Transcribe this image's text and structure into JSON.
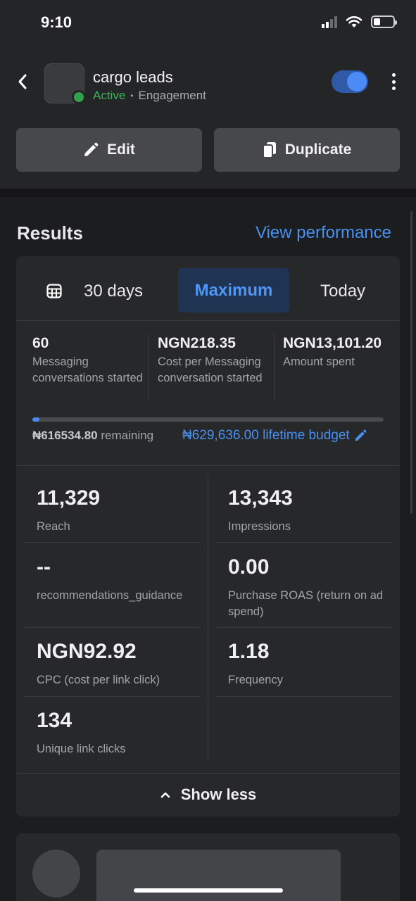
{
  "status_bar": {
    "time": "9:10"
  },
  "header": {
    "campaign_name": "cargo leads",
    "status": "Active",
    "objective": "Engagement",
    "edit_label": "Edit",
    "duplicate_label": "Duplicate",
    "toggle_on": true
  },
  "results": {
    "title": "Results",
    "view_performance": "View performance",
    "ranges": {
      "days": "30 days",
      "maximum": "Maximum",
      "today": "Today",
      "selected": "Maximum"
    },
    "top_metrics": [
      {
        "value": "60",
        "label": "Messaging conversations started"
      },
      {
        "value": "NGN218.35",
        "label": "Cost per Messaging conversation started"
      },
      {
        "value": "NGN13,101.20",
        "label": "Amount spent"
      }
    ],
    "budget": {
      "remaining_amount": "₦616534.80",
      "remaining_label": "remaining",
      "lifetime": "₦629,636.00 lifetime budget",
      "spent_fraction": 0.021
    },
    "grid": {
      "reach": {
        "value": "11,329",
        "label": "Reach"
      },
      "impressions": {
        "value": "13,343",
        "label": "Impressions"
      },
      "recommendations": {
        "value": "--",
        "label": "recommendations_guidance"
      },
      "purchase_roas": {
        "value": "0.00",
        "label": "Purchase ROAS (return on ad spend)"
      },
      "cpc": {
        "value": "NGN92.92",
        "label": "CPC (cost per link click)"
      },
      "frequency": {
        "value": "1.18",
        "label": "Frequency"
      },
      "unique_clicks": {
        "value": "134",
        "label": "Unique link clicks"
      }
    },
    "show_less": "Show less"
  },
  "colors": {
    "accent": "#4a90ee",
    "active": "#3db35a",
    "toggle": "#4c8bf5"
  }
}
